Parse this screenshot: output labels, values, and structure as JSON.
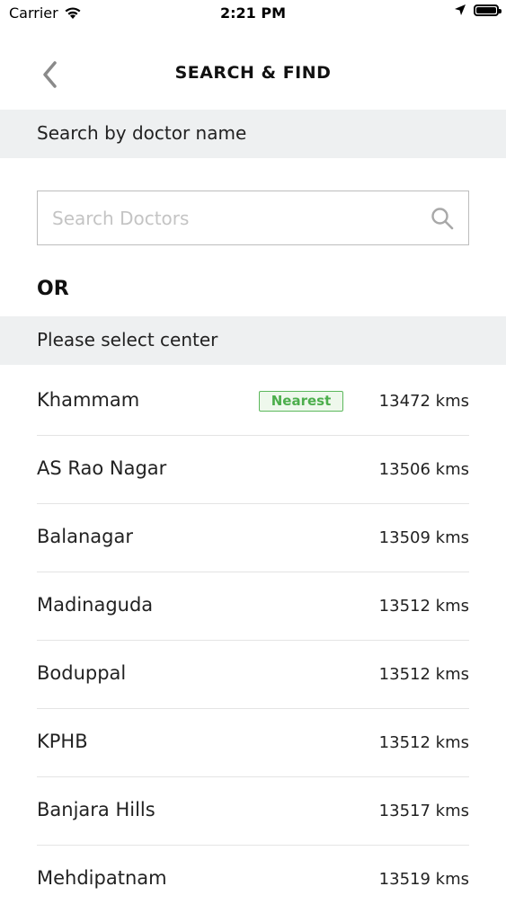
{
  "status_bar": {
    "carrier": "Carrier",
    "time": "2:21 PM",
    "battery_level": 1.0
  },
  "header": {
    "title": "SEARCH & FIND",
    "back_icon": "chevron-left-icon"
  },
  "doctor_section": {
    "label": "Search by doctor name"
  },
  "search": {
    "placeholder": "Search Doctors",
    "value": "",
    "icon": "search-icon"
  },
  "or_label": "OR",
  "center_section": {
    "label": "Please select center"
  },
  "centers": [
    {
      "name": "Khammam",
      "distance": "13472 kms",
      "badge": "Nearest"
    },
    {
      "name": "AS Rao Nagar",
      "distance": "13506 kms",
      "badge": ""
    },
    {
      "name": "Balanagar",
      "distance": "13509 kms",
      "badge": ""
    },
    {
      "name": "Madinaguda",
      "distance": "13512 kms",
      "badge": ""
    },
    {
      "name": "Boduppal",
      "distance": "13512 kms",
      "badge": ""
    },
    {
      "name": "KPHB",
      "distance": "13512 kms",
      "badge": ""
    },
    {
      "name": "Banjara Hills",
      "distance": "13517 kms",
      "badge": ""
    },
    {
      "name": "Mehdipatnam",
      "distance": "13519 kms",
      "badge": ""
    }
  ],
  "colors": {
    "section_bg": "#eef0f1",
    "badge_green": "#5cb85c",
    "placeholder": "#c4c4c4"
  }
}
